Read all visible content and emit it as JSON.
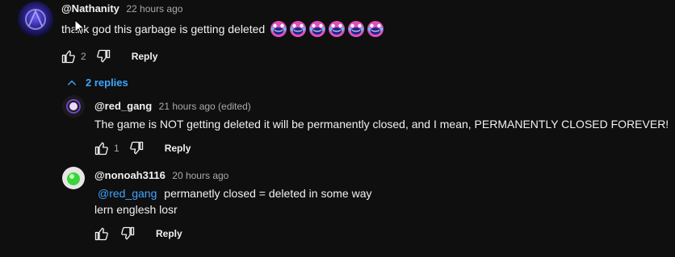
{
  "comments": [
    {
      "author": "@Nathanity",
      "time": "22 hours ago",
      "text": "thank god this garbage is getting deleted",
      "emoji_icon": "screaming-laughing-emoji-icon",
      "emoji_count": 6,
      "likes": "2",
      "reply_label": "Reply"
    }
  ],
  "replies_toggle": "2 replies",
  "replies": [
    {
      "author": "@red_gang",
      "time": "21 hours ago (edited)",
      "text": "The game is NOT getting deleted it will be permanently closed, and I mean, PERMANENTLY CLOSED FOREVER!",
      "likes": "1",
      "reply_label": "Reply"
    },
    {
      "author": "@nonoah3116",
      "time": "20 hours ago",
      "mention": "@red_gang",
      "text_line1": "permanetly closed = deleted in some way",
      "text_line2": "lern englesh losr",
      "likes": "",
      "reply_label": "Reply"
    }
  ],
  "colors": {
    "background": "#0f0f0f",
    "text": "#f1f1f1",
    "secondary": "#aaaaaa",
    "link": "#3ea6ff"
  }
}
